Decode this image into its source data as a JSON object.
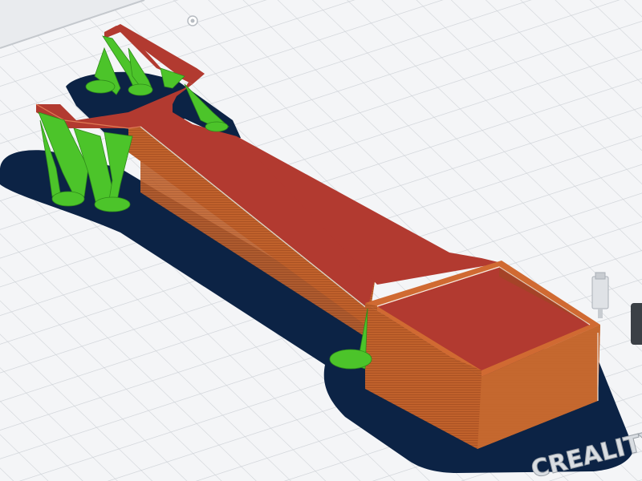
{
  "scene": {
    "bed_brand": "CREALITY",
    "colors": {
      "background": "#e9ebee",
      "bed_surface": "#f4f5f7",
      "grid_line": "#ced2d7",
      "brim": "#0c2345",
      "model_top": "#b23a30",
      "model_wall": "#c0612b",
      "model_wall_dark": "#9c4a22",
      "supports": "#4cc42a",
      "supports_dark": "#2f8c1a"
    },
    "icons": [
      "origin-marker-icon",
      "nozzle-position-icon"
    ]
  }
}
